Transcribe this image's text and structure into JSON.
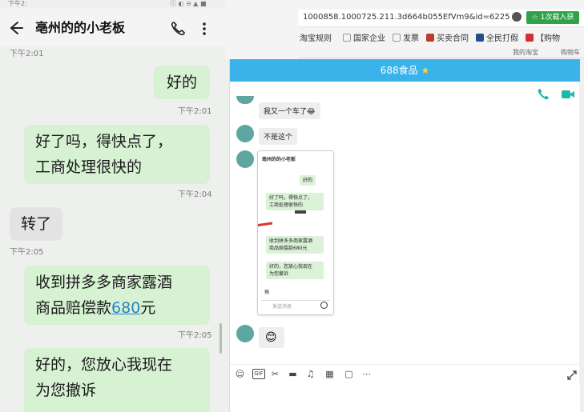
{
  "phone": {
    "status_fragment": "下午2:",
    "status_right": "ⓘ ◐ ⊖ ▲ ■",
    "title": "亳州的的小老板",
    "top_time": "下午2:01",
    "messages": [
      {
        "dir": "out",
        "text": "好的",
        "time": "下午2:01"
      },
      {
        "dir": "out",
        "text": "好了吗，得快点了，工商处理很快的",
        "line1": "好了吗，得快点了，",
        "line2": "工商处理很快的",
        "time": "下午2:04"
      },
      {
        "dir": "in",
        "text": "转了",
        "time": "下午2:05"
      },
      {
        "dir": "out",
        "line1": "收到拼多多商家露酒",
        "line2_prefix": "商品赔偿款",
        "amount": "680",
        "line2_suffix": "元",
        "time": "下午2:05"
      },
      {
        "dir": "out",
        "line1": "好的，您放心我现在",
        "line2": "为您撤诉",
        "time": "下午2:05"
      }
    ]
  },
  "browser": {
    "url": "1000858.1000725.211.3d664b055EfVm9&id=6225",
    "download_label": "☆ 1次载入获",
    "bookmarks": [
      {
        "label": "淘宝规则",
        "color": "#ffffff"
      },
      {
        "label": "国家企业",
        "color": "#ffffff"
      },
      {
        "label": "发票",
        "color": "#ffffff"
      },
      {
        "label": "买卖合同",
        "color": "#c0392b"
      },
      {
        "label": "全民打假",
        "color": "#1f4f8f"
      },
      {
        "label": "【购物",
        "color": "#d32f2f"
      }
    ],
    "sub_links": [
      "我的淘宝",
      "购物车"
    ]
  },
  "chat_window": {
    "title": "688食品",
    "title_star": "★",
    "messages": [
      {
        "text": "我又一个车了😂"
      },
      {
        "text": "不是这个"
      }
    ],
    "thumbnail": {
      "title": "亳州的的小老板",
      "msg1": "好的",
      "msg2_l1": "好了吗，得快点了，",
      "msg2_l2": "工商处理很快的",
      "msg3_l1": "收到拼多多商家露酒",
      "msg3_l2": "商品赔偿款680元",
      "msg4_l1": "好的，您放心我现在",
      "msg4_l2": "为您撤诉",
      "msg5": "搞",
      "input_placeholder": "发送消息"
    },
    "emoji_msg": "😊",
    "toolbar": [
      "emoji-icon",
      "gif-icon",
      "scissors-icon",
      "folder-icon",
      "music-icon",
      "image-icon",
      "window-icon",
      "more-icon"
    ],
    "toolbar_glyphs": [
      "☺",
      "GIF",
      "✂",
      "▬",
      "♫",
      "▦",
      "▢",
      "⋯"
    ]
  },
  "colors": {
    "bubble_out": "#d7f1d3",
    "bubble_in": "#e2e3e2",
    "header_blue": "#3ab3ea",
    "link": "#2a83c8",
    "download_green": "#2ea34a"
  }
}
